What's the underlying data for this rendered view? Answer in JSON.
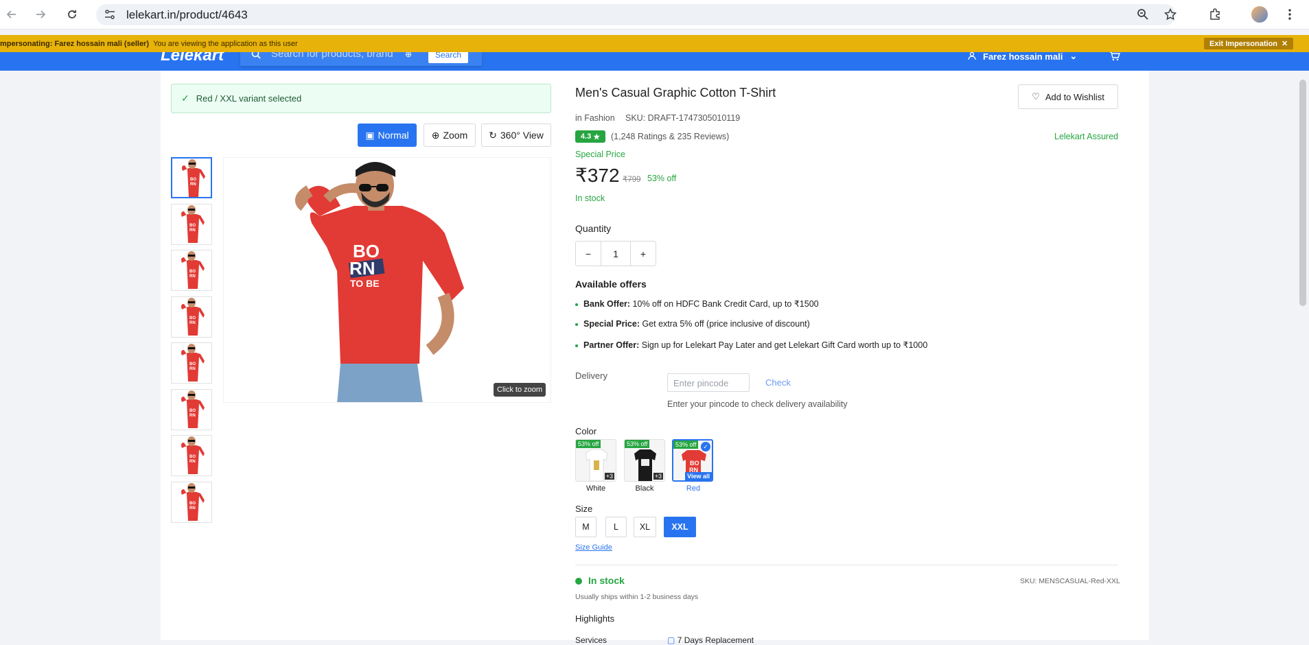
{
  "browser": {
    "url": "lelekart.in/product/4643",
    "icons": [
      "back-icon",
      "forward-icon",
      "reload-icon",
      "tune-icon",
      "zoom-icon",
      "star-icon",
      "extensions-icon",
      "profile-icon",
      "menu-icon"
    ]
  },
  "impersonation": {
    "label": "mpersonating: Farez hossain mali (seller)",
    "note": "You are viewing the application as this user",
    "exit_label": "Exit Impersonation"
  },
  "header": {
    "logo": "Lelekart",
    "search_placeholder": "Search for products, brand",
    "search_button": "Search",
    "user_name": "Farez hossain mali"
  },
  "gallery": {
    "variant_notice": "Red / XXL variant selected",
    "view_modes": [
      "Normal",
      "Zoom",
      "360° View"
    ],
    "active_view": "Normal",
    "thumbnail_count": 8,
    "zoom_hint": "Click to zoom",
    "main_print_text": [
      "BO",
      "RN",
      "TO BE"
    ]
  },
  "product": {
    "title": "Men's Casual Graphic Cotton T-Shirt",
    "wishlist_label": "Add to Wishlist",
    "category": "in Fashion",
    "sku": "SKU: DRAFT-1747305010119",
    "rating": "4.3",
    "rating_count": "(1,248 Ratings & 235 Reviews)",
    "assured": "Lelekart Assured",
    "special_price_label": "Special Price",
    "price": "₹372",
    "mrp": "₹799",
    "discount": "53% off",
    "stock": "In stock"
  },
  "quantity": {
    "label": "Quantity",
    "minus": "−",
    "value": "1",
    "plus": "+"
  },
  "offers": {
    "title": "Available offers",
    "items": [
      {
        "name": "Bank Offer:",
        "text": " 10% off on HDFC Bank Credit Card, up to ₹1500"
      },
      {
        "name": "Special Price:",
        "text": " Get extra 5% off (price inclusive of discount)"
      },
      {
        "name": "Partner Offer:",
        "text": " Sign up for Lelekart Pay Later and get Lelekart Gift Card worth up to ₹1000"
      }
    ]
  },
  "delivery": {
    "label": "Delivery",
    "placeholder": "Enter pincode",
    "check": "Check",
    "hint": "Enter your pincode to check delivery availability"
  },
  "color": {
    "label": "Color",
    "options": [
      {
        "name": "White",
        "off": "53% off",
        "badge": "+3"
      },
      {
        "name": "Black",
        "off": "53% off",
        "badge": "+3"
      },
      {
        "name": "Red",
        "off": "53% off",
        "badge": "View all"
      }
    ],
    "selected": "Red"
  },
  "size": {
    "label": "Size",
    "options": [
      "M",
      "L",
      "XL",
      "XXL"
    ],
    "selected": "XXL",
    "guide": "Size Guide"
  },
  "availability": {
    "status": "In stock",
    "shipping": "Usually ships within 1-2 business days",
    "sku": "SKU: MENSCASUAL-Red-XXL",
    "highlights": "Highlights",
    "services_label": "Services",
    "service_item": "7 Days Replacement"
  },
  "colors": {
    "brand": "#2874f0",
    "green": "#26a541",
    "banner": "#e7b20a",
    "shirt": "#e23a35"
  }
}
